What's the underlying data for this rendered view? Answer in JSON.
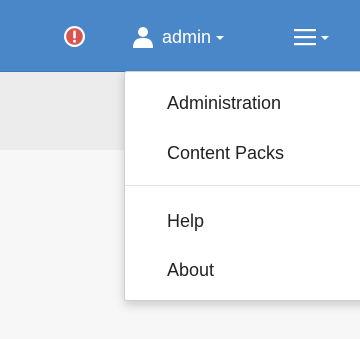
{
  "header": {
    "background_color": "#4a87c9",
    "alert_icon": "exclamation-circle-icon",
    "alert_color": "#d9534f",
    "user_icon": "user-icon",
    "username": "admin",
    "menu_icon": "hamburger-icon"
  },
  "dropdown": {
    "items": [
      {
        "label": "Administration"
      },
      {
        "label": "Content Packs"
      },
      {
        "label": "Help"
      },
      {
        "label": "About"
      }
    ]
  }
}
